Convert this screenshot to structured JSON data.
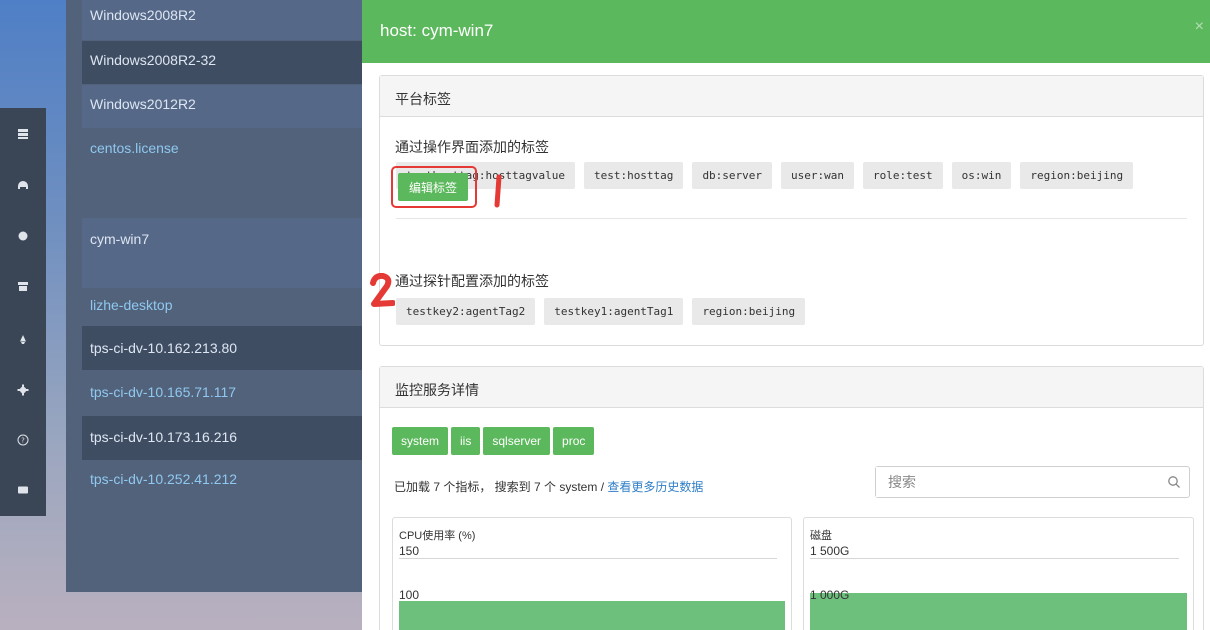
{
  "sidebar_rail": {
    "icons": [
      "server-icon",
      "dashboard-icon",
      "circle-icon",
      "archive-icon",
      "bell-icon",
      "gear-icon",
      "help-icon",
      "card-icon"
    ]
  },
  "hosts": [
    "Windows2008R2",
    "Windows2008R2-32",
    "Windows2012R2",
    "centos.license",
    "cym-win7",
    "lizhe-desktop",
    "tps-ci-dv-10.162.213.80",
    "tps-ci-dv-10.165.71.117",
    "tps-ci-dv-10.173.16.216",
    "tps-ci-dv-10.252.41.212"
  ],
  "modal": {
    "title": "host: cym-win7",
    "close": "×",
    "platform_tags": {
      "heading": "平台标签",
      "ui_tags_title": "通过操作界面添加的标签",
      "ui_tags": [
        "testhosttag:hosttagvalue",
        "test:hosttag",
        "db:server",
        "user:wan",
        "role:test",
        "os:win",
        "region:beijing"
      ],
      "edit_button": "编辑标签",
      "agent_tags_title": "通过探针配置添加的标签",
      "agent_tags": [
        "testkey2:agentTag2",
        "testkey1:agentTag1",
        "region:beijing"
      ]
    },
    "annotations": {
      "mark_1": "1",
      "mark_2": "2"
    },
    "monitoring": {
      "heading": "监控服务详情",
      "services": [
        "system",
        "iis",
        "sqlserver",
        "proc"
      ],
      "summary_text": "已加载 7 个指标， 搜索到 7 个 system  / ",
      "more_link": "查看更多历史数据",
      "search_placeholder": "搜索",
      "charts": [
        {
          "title": "CPU使用率 (%)",
          "ticks": [
            "150",
            "100"
          ]
        },
        {
          "title": "磁盘",
          "ticks": [
            "1 500G",
            "1 000G"
          ]
        }
      ]
    }
  },
  "colors": {
    "accent": "#5cb85c",
    "annotation": "#e53935",
    "link": "#2e7ec7"
  }
}
